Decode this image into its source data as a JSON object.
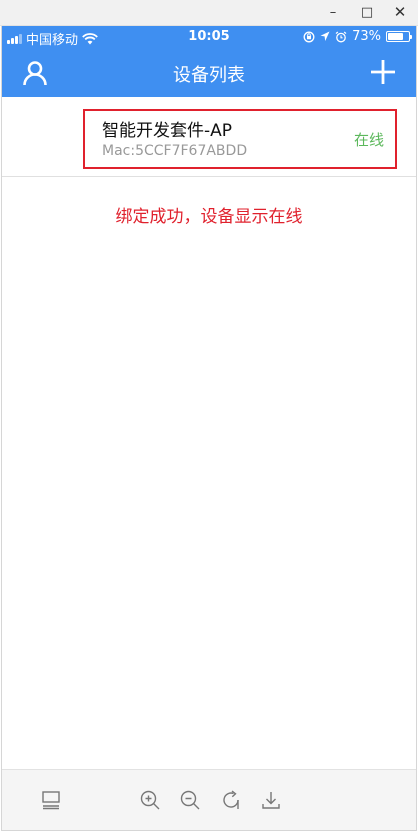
{
  "window": {
    "minimize_glyph": "–",
    "maximize_glyph": "□",
    "close_glyph": "✕"
  },
  "status_bar": {
    "carrier": "中国移动",
    "time": "10:05",
    "battery": "73%",
    "battery_level": 0.73,
    "icons": [
      "signal-icon",
      "wifi-icon",
      "orientation-lock-icon",
      "location-icon",
      "alarm-icon",
      "battery-icon"
    ]
  },
  "nav": {
    "title": "设备列表",
    "left_icon": "user-icon",
    "right_icon": "plus-icon"
  },
  "devices": [
    {
      "name": "智能开发套件-AP",
      "mac": "Mac:5CCF7F67ABDD",
      "status": "在线"
    }
  ],
  "annotation": "绑定成功，设备显示在线",
  "toolbar": {
    "icons": [
      "layout-icon",
      "zoom-in-icon",
      "zoom-out-icon",
      "rotate-icon",
      "download-icon"
    ]
  },
  "colors": {
    "primary": "#3f8ff1",
    "highlight": "#e0212d",
    "online": "#5cb85c"
  }
}
